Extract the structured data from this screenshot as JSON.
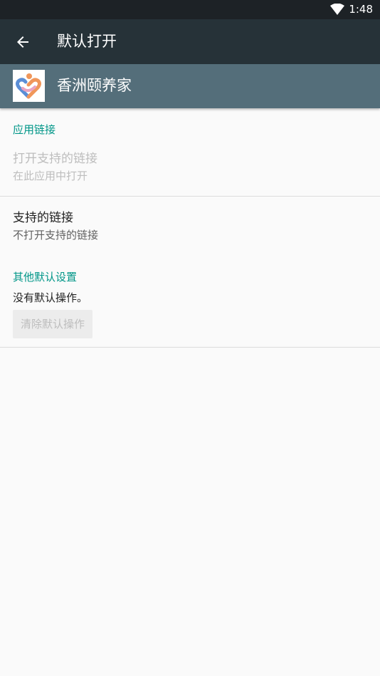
{
  "status_bar": {
    "time": "1:48",
    "icons": [
      "wifi-icon"
    ]
  },
  "toolbar": {
    "back_icon": "arrow-back-icon",
    "title": "默认打开"
  },
  "app": {
    "name": "香洲颐养家",
    "icon": "heart-logo-icon",
    "colors": {
      "logo_orange": "#f0965a",
      "logo_blue": "#5b8ed6",
      "logo_pink": "#e9a3c0"
    }
  },
  "app_links": {
    "section_label": "应用链接",
    "open_supported": {
      "title": "打开支持的链接",
      "summary": "在此应用中打开"
    },
    "supported_links": {
      "title": "支持的链接",
      "summary": "不打开支持的链接"
    }
  },
  "other_defaults": {
    "section_label": "其他默认设置",
    "summary": "没有默认操作。",
    "clear_button_label": "清除默认操作"
  },
  "colors": {
    "status_bar": "#1d2226",
    "toolbar": "#263238",
    "app_header": "#546e7a",
    "accent": "#009688",
    "background": "#fafafa"
  }
}
